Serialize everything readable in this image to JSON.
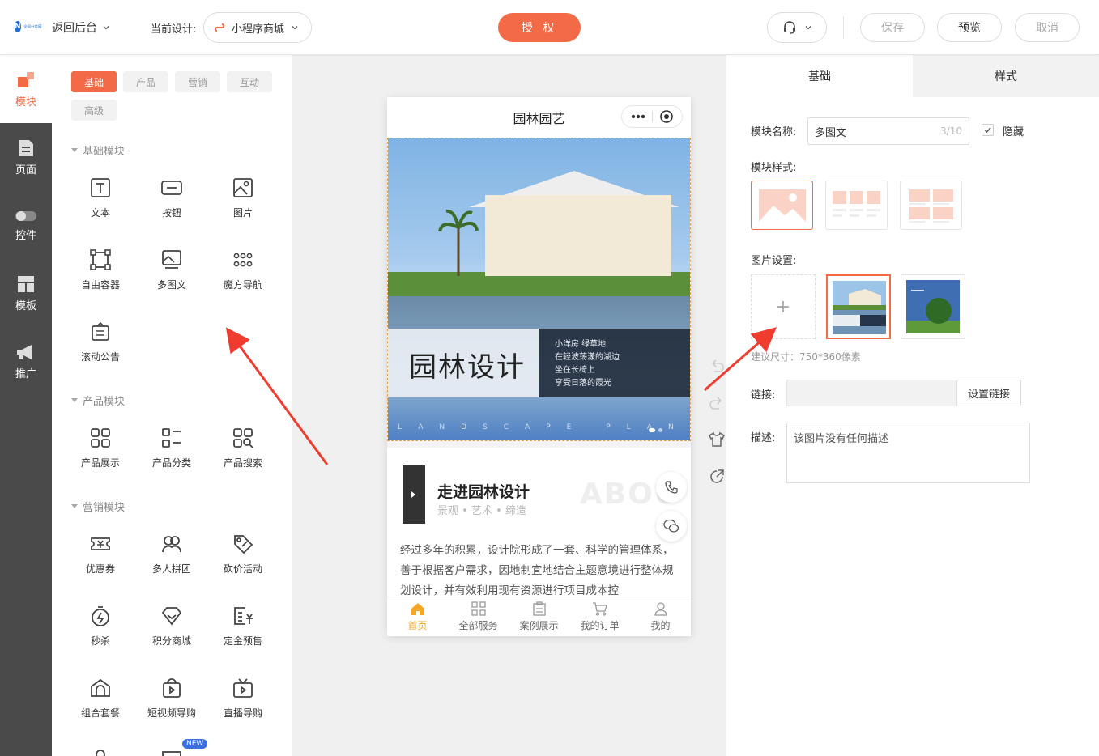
{
  "topbar": {
    "logo_text": "全国分类网",
    "back_label": "返回后台",
    "current_design_label": "当前设计:",
    "design_name": "小程序商城",
    "auth_label": "授 权",
    "save_label": "保存",
    "preview_label": "预览",
    "cancel_label": "取消"
  },
  "leftnav": {
    "items": [
      {
        "label": "模块",
        "icon": "module-icon"
      },
      {
        "label": "页面",
        "icon": "page-icon"
      },
      {
        "label": "控件",
        "icon": "toggle-icon"
      },
      {
        "label": "模板",
        "icon": "template-icon"
      },
      {
        "label": "推广",
        "icon": "megaphone-icon"
      }
    ]
  },
  "panel": {
    "tabs": [
      "基础",
      "产品",
      "营销",
      "互动",
      "高级"
    ],
    "sections": {
      "basic": "基础模块",
      "product": "产品模块",
      "marketing": "营销模块"
    },
    "basic_modules": [
      "文本",
      "按钮",
      "图片",
      "自由容器",
      "多图文",
      "魔方导航",
      "滚动公告"
    ],
    "product_modules": [
      "产品展示",
      "产品分类",
      "产品搜索"
    ],
    "marketing_modules": [
      "优惠券",
      "多人拼团",
      "砍价活动",
      "秒杀",
      "积分商城",
      "定金预售",
      "组合套餐",
      "短视频导购",
      "直播导购"
    ],
    "new_badge": "NEW"
  },
  "phone": {
    "title": "园林园艺",
    "banner": {
      "title": "园林设计",
      "lines": [
        "小洋房 绿草地",
        "在轻波荡漾的湖边",
        "坐在长椅上",
        "享受日落的霞光"
      ],
      "footer": "LANDSCAPE PLANNING"
    },
    "about": {
      "title": "走进园林设计",
      "subtitle": "景观 • 艺术 • 缔造",
      "watermark": "ABOU"
    },
    "paragraph": "经过多年的积累，设计院形成了一套、科学的管理体系，善于根据客户需求，因地制宜地结合主题意境进行整体规划设计，并有效利用现有资源进行项目成本控",
    "tabbar": [
      "首页",
      "全部服务",
      "案例展示",
      "我的订单",
      "我的"
    ]
  },
  "right": {
    "tabs": [
      "基础",
      "样式"
    ],
    "module_name_label": "模块名称:",
    "module_name_value": "多图文",
    "module_name_count": "3/10",
    "hide_label": "隐藏",
    "module_style_label": "模块样式:",
    "image_settings_label": "图片设置:",
    "suggest_size": "建议尺寸：750*360像素",
    "link_label": "链接:",
    "link_button": "设置链接",
    "desc_label": "描述:",
    "desc_value": "该图片没有任何描述"
  },
  "colors": {
    "accent": "#f26b46",
    "nav_dark": "#4a4a4a",
    "tab_active": "#f5a623"
  }
}
